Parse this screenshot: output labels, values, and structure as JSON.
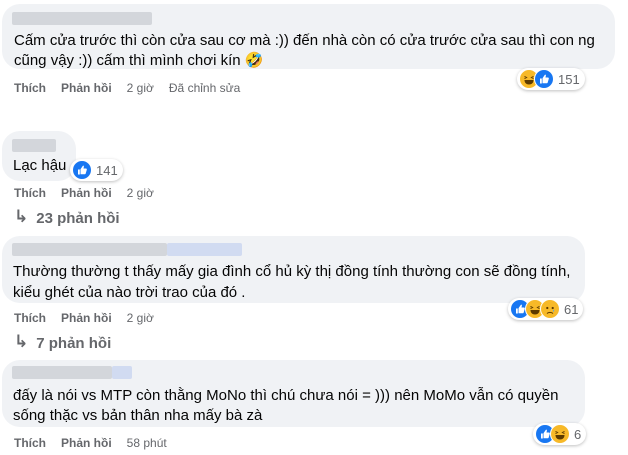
{
  "labels": {
    "like": "Thích",
    "reply": "Phản hồi"
  },
  "comments": [
    {
      "text_lines": [
        "Cấm cửa trước thì còn cửa sau cơ mà :)) đến nhà còn có cửa trước cửa sau thì con ng",
        "cũng vậy :)) cấm thì mình chơi kín 🤣"
      ],
      "time": "2 giờ",
      "edited": "Đã chỉnh sửa",
      "reactions": [
        "haha",
        "like"
      ],
      "reaction_count": "151"
    },
    {
      "text_lines": [
        "Lạc hậu"
      ],
      "time": "2 giờ",
      "reactions": [
        "like"
      ],
      "reaction_count": "141",
      "replies": "23 phản hồi"
    },
    {
      "text_lines": [
        "Thường thường t thấy mấy gia đình cổ hủ kỳ thị đồng tính thường con sẽ đồng tính,",
        "kiểu ghét của nào trời trao của đó ."
      ],
      "time": "2 giờ",
      "reactions": [
        "like",
        "haha",
        "sad"
      ],
      "reaction_count": "61",
      "replies": "7 phản hồi"
    },
    {
      "text_lines": [
        "đấy là nói vs MTP còn thằng MoNo thì chú chưa nói = ))) nên MoMo vẫn có quyền",
        "sống thặc vs bản thân nha mấy bà zà"
      ],
      "time": "58 phút",
      "reactions": [
        "like",
        "haha"
      ],
      "reaction_count": "6"
    }
  ]
}
